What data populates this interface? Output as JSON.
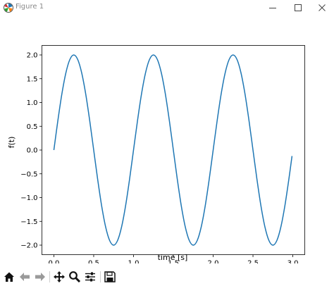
{
  "window": {
    "title": "Figure 1",
    "icons": {
      "app": "matplotlib-icon",
      "minimize": "minimize-icon",
      "maximize": "maximize-icon",
      "close": "close-icon"
    }
  },
  "toolbar": {
    "buttons": [
      {
        "name": "home-button",
        "icon": "home-icon",
        "enabled": true
      },
      {
        "name": "back-button",
        "icon": "arrow-left-icon",
        "enabled": false
      },
      {
        "name": "forward-button",
        "icon": "arrow-right-icon",
        "enabled": false
      },
      {
        "name": "pan-button",
        "icon": "move-icon",
        "enabled": true
      },
      {
        "name": "zoom-button",
        "icon": "magnifier-icon",
        "enabled": true
      },
      {
        "name": "configure-subplots-button",
        "icon": "sliders-icon",
        "enabled": true
      },
      {
        "name": "save-button",
        "icon": "floppy-icon",
        "enabled": true
      }
    ]
  },
  "chart_data": {
    "type": "line",
    "title": "",
    "xlabel": "time [s]",
    "ylabel": "f(t)",
    "xlim": [
      -0.15,
      3.15
    ],
    "ylim": [
      -2.2,
      2.2
    ],
    "xticks": [
      "0.0",
      "0.5",
      "1.0",
      "1.5",
      "2.0",
      "2.5",
      "3.0"
    ],
    "xtick_values": [
      0,
      0.5,
      1,
      1.5,
      2,
      2.5,
      3
    ],
    "yticks": [
      "−2.0",
      "−1.5",
      "−1.0",
      "−0.5",
      "0.0",
      "0.5",
      "1.0",
      "1.5",
      "2.0"
    ],
    "ytick_values": [
      -2,
      -1.5,
      -1,
      -0.5,
      0,
      0.5,
      1,
      1.5,
      2
    ],
    "grid": false,
    "series": [
      {
        "color": "#1f77b4",
        "x": [
          0.0,
          0.05,
          0.1,
          0.15,
          0.2,
          0.25,
          0.3,
          0.35,
          0.4,
          0.45,
          0.5,
          0.55,
          0.6,
          0.65,
          0.7,
          0.75,
          0.8,
          0.85,
          0.9,
          0.95,
          1.0,
          1.05,
          1.1,
          1.15,
          1.2,
          1.25,
          1.3,
          1.35,
          1.4,
          1.45,
          1.5,
          1.55,
          1.6,
          1.65,
          1.7,
          1.75,
          1.8,
          1.85,
          1.9,
          1.95,
          2.0,
          2.05,
          2.1,
          2.15,
          2.2,
          2.25,
          2.3,
          2.35,
          2.4,
          2.45,
          2.5,
          2.55,
          2.6,
          2.65,
          2.7,
          2.75,
          2.8,
          2.85,
          2.9,
          2.95,
          2.99
        ],
        "y": [
          0.0,
          0.618,
          1.176,
          1.618,
          1.902,
          2.0,
          1.902,
          1.618,
          1.176,
          0.618,
          0.0,
          -0.618,
          -1.176,
          -1.618,
          -1.902,
          -2.0,
          -1.902,
          -1.618,
          -1.176,
          -0.618,
          0.0,
          0.618,
          1.176,
          1.618,
          1.902,
          2.0,
          1.902,
          1.618,
          1.176,
          0.618,
          0.0,
          -0.618,
          -1.176,
          -1.618,
          -1.902,
          -2.0,
          -1.902,
          -1.618,
          -1.176,
          -0.618,
          0.0,
          0.618,
          1.176,
          1.618,
          1.902,
          2.0,
          1.902,
          1.618,
          1.176,
          0.618,
          0.0,
          -0.618,
          -1.176,
          -1.618,
          -1.902,
          -2.0,
          -1.902,
          -1.618,
          -1.176,
          -0.618,
          -0.126
        ]
      }
    ]
  }
}
